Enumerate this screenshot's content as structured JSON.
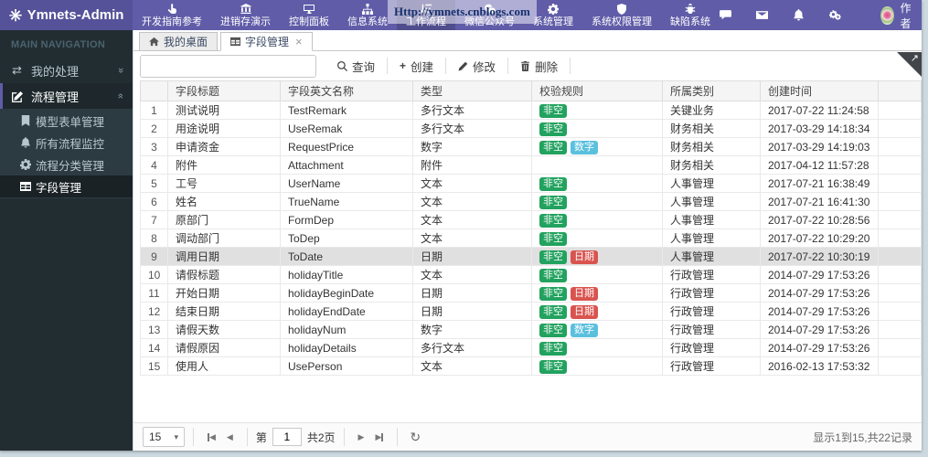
{
  "colors": {
    "header": "#605ca8",
    "logo_bg": "#555299",
    "sidebar_bg": "#222d32",
    "submenu_bg": "#2c3b41",
    "success": "#22a25f",
    "info": "#5bc0de",
    "danger": "#d9534f"
  },
  "brand": {
    "title": "Ymnets-Admin",
    "icon": "burst-logo-icon"
  },
  "watermark": "Http://ymnets.cnblogs.com",
  "topnav": {
    "items": [
      {
        "name": "nav-dev-guide",
        "label": "开发指南参考",
        "icon": "hand-pointer-icon",
        "active": false
      },
      {
        "name": "nav-invoicing-demo",
        "label": "进销存演示",
        "icon": "bank-icon",
        "active": false
      },
      {
        "name": "nav-control-panel",
        "label": "控制面板",
        "icon": "desktop-icon",
        "active": false
      },
      {
        "name": "nav-info-system",
        "label": "信息系统",
        "icon": "sitemap-icon",
        "active": false
      },
      {
        "name": "nav-workflow",
        "label": "工作流程",
        "icon": "workflow-sort-icon",
        "active": true
      },
      {
        "name": "nav-wechat-account",
        "label": "微信公众号",
        "icon": "wechat-icon",
        "active": false
      },
      {
        "name": "nav-system-admin",
        "label": "系统管理",
        "icon": "gear-icon",
        "active": false
      },
      {
        "name": "nav-permission-admin",
        "label": "系统权限管理",
        "icon": "shield-icon",
        "active": false
      },
      {
        "name": "nav-defect-system",
        "label": "缺陷系统",
        "icon": "bug-icon",
        "active": false
      }
    ],
    "quick_icons": [
      {
        "name": "comments-icon"
      },
      {
        "name": "envelope-icon"
      },
      {
        "name": "bell-icon"
      },
      {
        "name": "cogs-icon"
      }
    ],
    "user": {
      "name": "作者"
    }
  },
  "sidebar": {
    "header": "MAIN NAVIGATION",
    "items": [
      {
        "label": "我的处理",
        "icon": "exchange-icon",
        "chevron": "down",
        "active": false,
        "children": []
      },
      {
        "label": "流程管理",
        "icon": "edit-icon",
        "chevron": "up",
        "active": true,
        "children": [
          {
            "label": "模型表单管理",
            "icon": "book-icon",
            "active": false
          },
          {
            "label": "所有流程监控",
            "icon": "bell-icon",
            "active": false
          },
          {
            "label": "流程分类管理",
            "icon": "gear-icon",
            "active": false
          },
          {
            "label": "字段管理",
            "icon": "table-icon",
            "active": true
          }
        ]
      }
    ]
  },
  "tabs": [
    {
      "label": "我的桌面",
      "icon": "home-icon",
      "active": false,
      "closable": false
    },
    {
      "label": "字段管理",
      "icon": "table-icon",
      "active": true,
      "closable": true
    }
  ],
  "toolbar": {
    "search": {
      "value": "",
      "placeholder": ""
    },
    "buttons": [
      {
        "name": "query-button",
        "label": "查询",
        "icon": "search-icon"
      },
      {
        "name": "create-button",
        "label": "创建",
        "icon": "plus-icon"
      },
      {
        "name": "modify-button",
        "label": "修改",
        "icon": "pencil-icon"
      },
      {
        "name": "delete-button",
        "label": "删除",
        "icon": "trash-icon"
      }
    ]
  },
  "table": {
    "columns": [
      "",
      "字段标题",
      "字段英文名称",
      "类型",
      "校验规则",
      "所属类别",
      "创建时间"
    ],
    "rows": [
      {
        "num": "1",
        "title": "测试说明",
        "en_name": "TestRemark",
        "type": "多行文本",
        "rules": [
          {
            "text": "非空",
            "style": "success"
          }
        ],
        "category": "关键业务",
        "created": "2017-07-22 11:24:58",
        "selected": false
      },
      {
        "num": "2",
        "title": "用途说明",
        "en_name": "UseRemak",
        "type": "多行文本",
        "rules": [
          {
            "text": "非空",
            "style": "success"
          }
        ],
        "category": "财务相关",
        "created": "2017-03-29 14:18:34",
        "selected": false
      },
      {
        "num": "3",
        "title": "申请资金",
        "en_name": "RequestPrice",
        "type": "数字",
        "rules": [
          {
            "text": "非空",
            "style": "success"
          },
          {
            "text": "数字",
            "style": "info"
          }
        ],
        "category": "财务相关",
        "created": "2017-03-29 14:19:03",
        "selected": false
      },
      {
        "num": "4",
        "title": "附件",
        "en_name": "Attachment",
        "type": "附件",
        "rules": [],
        "category": "财务相关",
        "created": "2017-04-12 11:57:28",
        "selected": false
      },
      {
        "num": "5",
        "title": "工号",
        "en_name": "UserName",
        "type": "文本",
        "rules": [
          {
            "text": "非空",
            "style": "success"
          }
        ],
        "category": "人事管理",
        "created": "2017-07-21 16:38:49",
        "selected": false
      },
      {
        "num": "6",
        "title": "姓名",
        "en_name": "TrueName",
        "type": "文本",
        "rules": [
          {
            "text": "非空",
            "style": "success"
          }
        ],
        "category": "人事管理",
        "created": "2017-07-21 16:41:30",
        "selected": false
      },
      {
        "num": "7",
        "title": "原部门",
        "en_name": "FormDep",
        "type": "文本",
        "rules": [
          {
            "text": "非空",
            "style": "success"
          }
        ],
        "category": "人事管理",
        "created": "2017-07-22 10:28:56",
        "selected": false
      },
      {
        "num": "8",
        "title": "调动部门",
        "en_name": "ToDep",
        "type": "文本",
        "rules": [
          {
            "text": "非空",
            "style": "success"
          }
        ],
        "category": "人事管理",
        "created": "2017-07-22 10:29:20",
        "selected": false
      },
      {
        "num": "9",
        "title": "调用日期",
        "en_name": "ToDate",
        "type": "日期",
        "rules": [
          {
            "text": "非空",
            "style": "success"
          },
          {
            "text": "日期",
            "style": "danger"
          }
        ],
        "category": "人事管理",
        "created": "2017-07-22 10:30:19",
        "selected": true
      },
      {
        "num": "10",
        "title": "请假标题",
        "en_name": "holidayTitle",
        "type": "文本",
        "rules": [
          {
            "text": "非空",
            "style": "success"
          }
        ],
        "category": "行政管理",
        "created": "2014-07-29 17:53:26",
        "selected": false
      },
      {
        "num": "11",
        "title": "开始日期",
        "en_name": "holidayBeginDate",
        "type": "日期",
        "rules": [
          {
            "text": "非空",
            "style": "success"
          },
          {
            "text": "日期",
            "style": "danger"
          }
        ],
        "category": "行政管理",
        "created": "2014-07-29 17:53:26",
        "selected": false
      },
      {
        "num": "12",
        "title": "结束日期",
        "en_name": "holidayEndDate",
        "type": "日期",
        "rules": [
          {
            "text": "非空",
            "style": "success"
          },
          {
            "text": "日期",
            "style": "danger"
          }
        ],
        "category": "行政管理",
        "created": "2014-07-29 17:53:26",
        "selected": false
      },
      {
        "num": "13",
        "title": "请假天数",
        "en_name": "holidayNum",
        "type": "数字",
        "rules": [
          {
            "text": "非空",
            "style": "success"
          },
          {
            "text": "数字",
            "style": "info"
          }
        ],
        "category": "行政管理",
        "created": "2014-07-29 17:53:26",
        "selected": false
      },
      {
        "num": "14",
        "title": "请假原因",
        "en_name": "holidayDetails",
        "type": "多行文本",
        "rules": [
          {
            "text": "非空",
            "style": "success"
          }
        ],
        "category": "行政管理",
        "created": "2014-07-29 17:53:26",
        "selected": false
      },
      {
        "num": "15",
        "title": "使用人",
        "en_name": "UsePerson",
        "type": "文本",
        "rules": [
          {
            "text": "非空",
            "style": "success"
          }
        ],
        "category": "行政管理",
        "created": "2016-02-13 17:53:32",
        "selected": false
      }
    ]
  },
  "pagination": {
    "page_size": "15",
    "page_prefix": "第",
    "page_value": "1",
    "page_suffix": "共2页",
    "summary": "显示1到15,共22记录"
  }
}
